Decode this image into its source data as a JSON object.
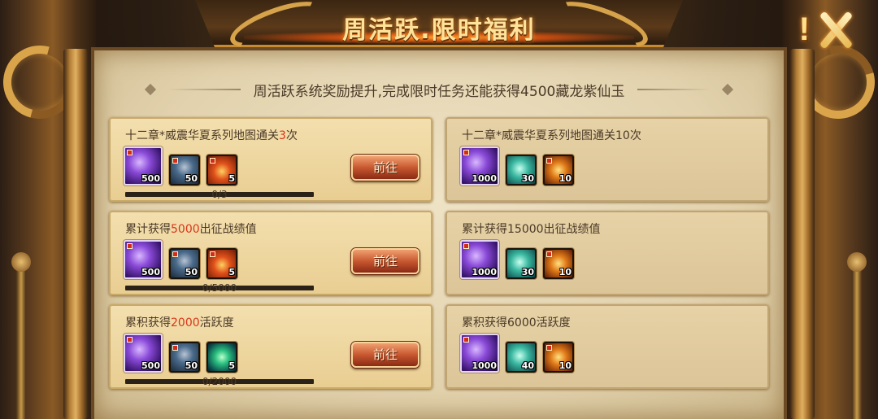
{
  "header": {
    "title": "周活跃.限时福利",
    "alert_symbol": "!"
  },
  "subtitle": "周活跃系统奖励提升,完成限时任务还能获得4500藏龙紫仙玉",
  "left_tasks": [
    {
      "title_prefix": "十二章*威震华夏系列地图通关",
      "highlight": "3",
      "title_suffix": "次",
      "button": "前往",
      "progress": "0/3",
      "progress_fraction": 0,
      "rewards": [
        {
          "icon": "violet-gem-icon",
          "qty": "500"
        },
        {
          "icon": "sword-icon",
          "qty": "50"
        },
        {
          "icon": "fire-pouch-icon",
          "qty": "5"
        }
      ]
    },
    {
      "title_prefix": "累计获得",
      "highlight": "5000",
      "title_suffix": "出征战绩值",
      "button": "前往",
      "progress": "0/5000",
      "progress_fraction": 0,
      "rewards": [
        {
          "icon": "violet-gem-icon",
          "qty": "500"
        },
        {
          "icon": "sword-icon",
          "qty": "50"
        },
        {
          "icon": "fire-pouch-icon",
          "qty": "5"
        }
      ]
    },
    {
      "title_prefix": "累积获得",
      "highlight": "2000",
      "title_suffix": "活跃度",
      "button": "前往",
      "progress": "0/2000",
      "progress_fraction": 0,
      "rewards": [
        {
          "icon": "violet-gem-icon",
          "qty": "500"
        },
        {
          "icon": "sword-icon",
          "qty": "50"
        },
        {
          "icon": "green-gem-icon",
          "qty": "5"
        }
      ]
    }
  ],
  "right_tasks": [
    {
      "title": "十二章*威震华夏系列地图通关10次",
      "rewards": [
        {
          "icon": "violet-gem-icon",
          "qty": "1000"
        },
        {
          "icon": "teal-stars-icon",
          "qty": "30"
        },
        {
          "icon": "gold-crown-icon",
          "qty": "10"
        }
      ]
    },
    {
      "title": "累计获得15000出征战绩值",
      "rewards": [
        {
          "icon": "violet-gem-icon",
          "qty": "1000"
        },
        {
          "icon": "teal-stars-icon",
          "qty": "30"
        },
        {
          "icon": "gold-crown-icon",
          "qty": "10"
        }
      ]
    },
    {
      "title": "累积获得6000活跃度",
      "rewards": [
        {
          "icon": "violet-gem-icon",
          "qty": "1000"
        },
        {
          "icon": "teal-stars-icon",
          "qty": "40"
        },
        {
          "icon": "gold-crown-icon",
          "qty": "10"
        }
      ]
    }
  ],
  "colors": {
    "highlight": "#d8361a",
    "title_gold": "#ffe39a",
    "parchment": "#efe3c6"
  }
}
